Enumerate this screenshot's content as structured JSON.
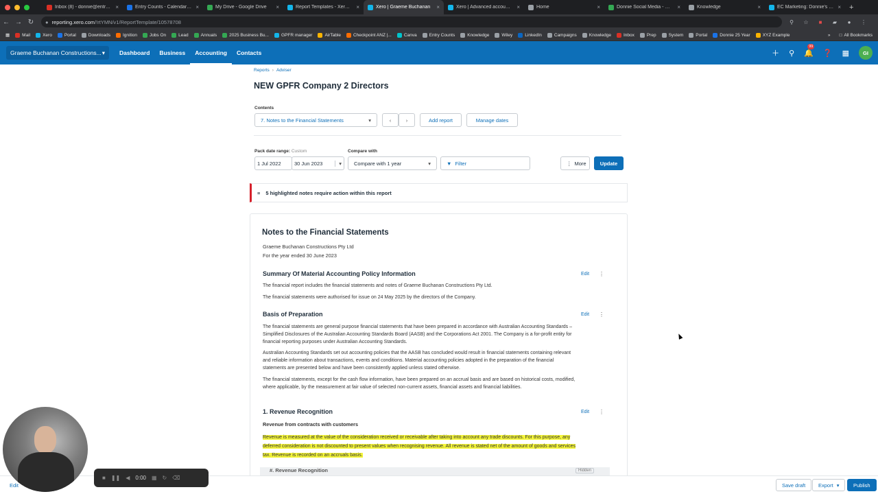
{
  "browser": {
    "tabs": [
      {
        "title": "Inbox (8) - donnie@entryco",
        "color": "#d93025"
      },
      {
        "title": "Entry Counts - Calendar - W",
        "color": "#1a73e8"
      },
      {
        "title": "My Drive - Google Drive",
        "color": "#34a853"
      },
      {
        "title": "Report Templates - Xero HQ",
        "color": "#13b5ea"
      },
      {
        "title": "Xero | Graeme Buchanan",
        "color": "#13b5ea",
        "active": true
      },
      {
        "title": "Xero | Advanced accountin",
        "color": "#13b5ea"
      },
      {
        "title": "Home",
        "color": "#9aa0a6"
      },
      {
        "title": "Donnie Social Media - Goog",
        "color": "#34a853"
      },
      {
        "title": "Knowledge",
        "color": "#9aa0a6"
      },
      {
        "title": "EC Marketing: Donnie's Tas",
        "color": "#13b5ea"
      }
    ],
    "url_host": "reporting.xero.com",
    "url_path": "/!rtYMN/v1/ReportTemplate/10578708",
    "bookmarks": [
      {
        "label": "Mail",
        "color": "#d93025"
      },
      {
        "label": "Xero",
        "color": "#13b5ea"
      },
      {
        "label": "Portal",
        "color": "#1a73e8"
      },
      {
        "label": "Downloads",
        "color": "#9aa0a6"
      },
      {
        "label": "Ignition",
        "color": "#ff6d00"
      },
      {
        "label": "Jobs On",
        "color": "#34a853"
      },
      {
        "label": "Lead",
        "color": "#34a853"
      },
      {
        "label": "Annuals",
        "color": "#34a853"
      },
      {
        "label": "2025 Business Bu...",
        "color": "#34a853"
      },
      {
        "label": "GPFR manager",
        "color": "#13b5ea"
      },
      {
        "label": "AirTable",
        "color": "#fcb400"
      },
      {
        "label": "Checkpoint ANZ |...",
        "color": "#ff6d00"
      },
      {
        "label": "Canva",
        "color": "#00c4cc"
      },
      {
        "label": "Entry Counts",
        "color": "#9aa0a6"
      },
      {
        "label": "Knowledge",
        "color": "#9aa0a6"
      },
      {
        "label": "Wiley",
        "color": "#9aa0a6"
      },
      {
        "label": "LinkedIn",
        "color": "#0a66c2"
      },
      {
        "label": "Campaigns",
        "color": "#9aa0a6"
      },
      {
        "label": "Knowledge",
        "color": "#9aa0a6"
      },
      {
        "label": "Inbox",
        "color": "#d93025"
      },
      {
        "label": "Prep",
        "color": "#9aa0a6"
      },
      {
        "label": "System",
        "color": "#9aa0a6"
      },
      {
        "label": "Portal",
        "color": "#9aa0a6"
      },
      {
        "label": "Donnie 25 Year",
        "color": "#1a73e8"
      },
      {
        "label": "XYZ Example",
        "color": "#fcb400"
      }
    ],
    "all_bookmarks": "All Bookmarks"
  },
  "xero_nav": {
    "org_name": "Graeme Buchanan Constructions...",
    "links": [
      "Dashboard",
      "Business",
      "Accounting",
      "Contacts"
    ],
    "active_link": "Accounting",
    "notif_count": "99",
    "avatar_initials": "GI",
    "brand_color": "#0d6fb8"
  },
  "breadcrumb": [
    "Reports",
    "Adviser"
  ],
  "page_title": "NEW GPFR Company 2 Directors",
  "contents": {
    "label": "Contents",
    "selected": "7. Notes to the Financial Statements",
    "add_report": "Add report",
    "manage_dates": "Manage dates"
  },
  "filters": {
    "date_range_label": "Pack date range:",
    "date_range_type": "Custom",
    "start_date": "1 Jul 2022",
    "end_date": "30 Jun 2023",
    "compare_label": "Compare with",
    "compare_value": "Compare with 1 year",
    "filter_label": "Filter",
    "more_label": "More",
    "update_label": "Update"
  },
  "alert": {
    "text": "5 highlighted notes require action within this report"
  },
  "report": {
    "heading": "Notes to the Financial Statements",
    "company": "Graeme Buchanan Constructions Pty Ltd",
    "period": "For the year ended 30 June 2023",
    "edit_label": "Edit",
    "sections": {
      "summary": {
        "title": "Summary Of Material Accounting Policy Information",
        "p1": "The financial report includes the financial statements and notes of Graeme Buchanan Constructions Pty Ltd.",
        "p2": "The financial statements were authorised for issue on 24 May 2025 by the directors of the Company."
      },
      "basis": {
        "title": "Basis of Preparation",
        "p1": "The financial statements are general purpose financial statements that have been prepared in accordance with Australian Accounting Standards – Simplified Disclosures of the Australian Accounting Standards Board (AASB) and the Corporations Act 2001. The Company is a for-profit entity for financial reporting purposes under Australian Accounting Standards.",
        "p2": "Australian Accounting Standards set out accounting policies that the AASB has concluded would result in financial statements containing relevant and reliable information about transactions, events and conditions. Material accounting policies adopted in the preparation of the financial statements are presented below and have been consistently applied unless stated otherwise.",
        "p3": "The financial statements, except for the cash flow information, have been prepared on an accrual basis and are based on historical costs, modified, where applicable, by the measurement at fair value of selected non-current assets, financial assets and financial liabilities."
      },
      "revenue": {
        "title": "1. Revenue Recognition",
        "subtitle": "Revenue from contracts with customers",
        "highlighted": "Revenue is measured at the value of the consideration received or receivable after taking into account any trade discounts. For this purpose, any deferred consideration is not discounted to present values when recognising revenue. All revenue is stated net of the amount of goods and services tax. Revenue is recorded on an accruals basis.",
        "hidden_row": "#. Revenue Recognition",
        "hidden_tag": "Hidden"
      }
    }
  },
  "bottom": {
    "edit": "Edit",
    "save_draft": "Save draft",
    "export": "Export",
    "publish": "Publish",
    "rec_time": "0:00"
  }
}
